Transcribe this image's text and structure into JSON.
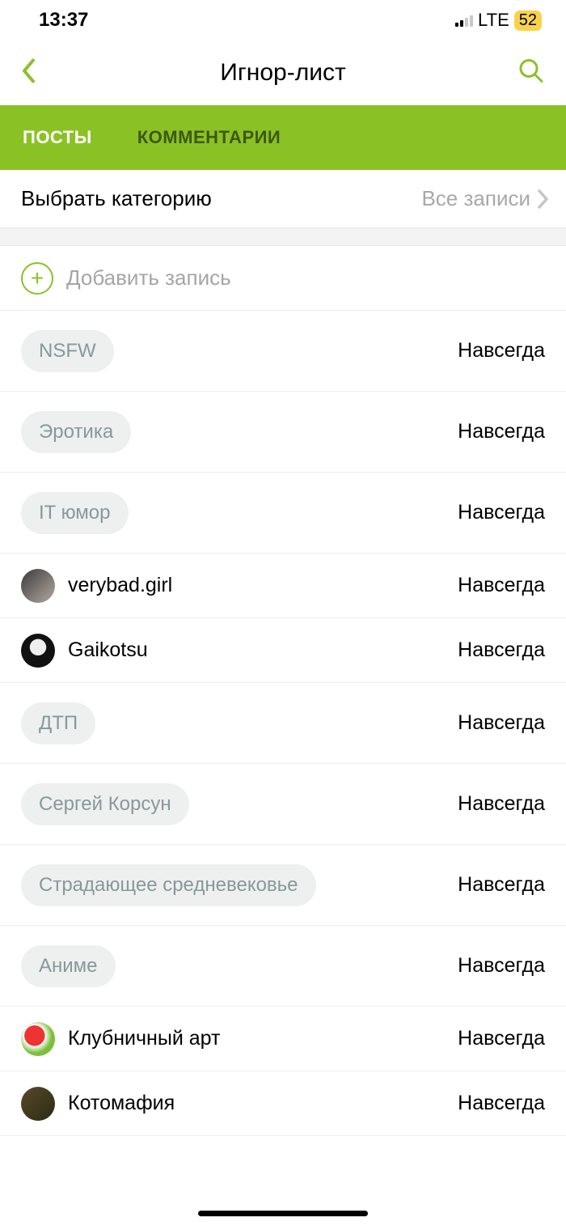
{
  "status": {
    "time": "13:37",
    "net": "LTE",
    "battery": "52"
  },
  "nav": {
    "title": "Игнор-лист"
  },
  "tabs": {
    "posts": "ПОСТЫ",
    "comments": "КОММЕНТАРИИ"
  },
  "category": {
    "label": "Выбрать категорию",
    "value": "Все записи"
  },
  "add": {
    "label": "Добавить запись"
  },
  "duration": "Навсегда",
  "items": [
    {
      "type": "tag",
      "label": "NSFW"
    },
    {
      "type": "tag",
      "label": "Эротика"
    },
    {
      "type": "tag",
      "label": "IT юмор"
    },
    {
      "type": "user",
      "label": "verybad.girl",
      "avatar": "a1"
    },
    {
      "type": "user",
      "label": "Gaikotsu",
      "avatar": "a2"
    },
    {
      "type": "tag",
      "label": "ДТП"
    },
    {
      "type": "tag",
      "label": "Сергей Корсун"
    },
    {
      "type": "tag",
      "label": "Страдающее средневековье"
    },
    {
      "type": "tag",
      "label": "Аниме"
    },
    {
      "type": "user",
      "label": "Клубничный арт",
      "avatar": "a3"
    },
    {
      "type": "user",
      "label": "Котомафия",
      "avatar": "a4"
    }
  ]
}
